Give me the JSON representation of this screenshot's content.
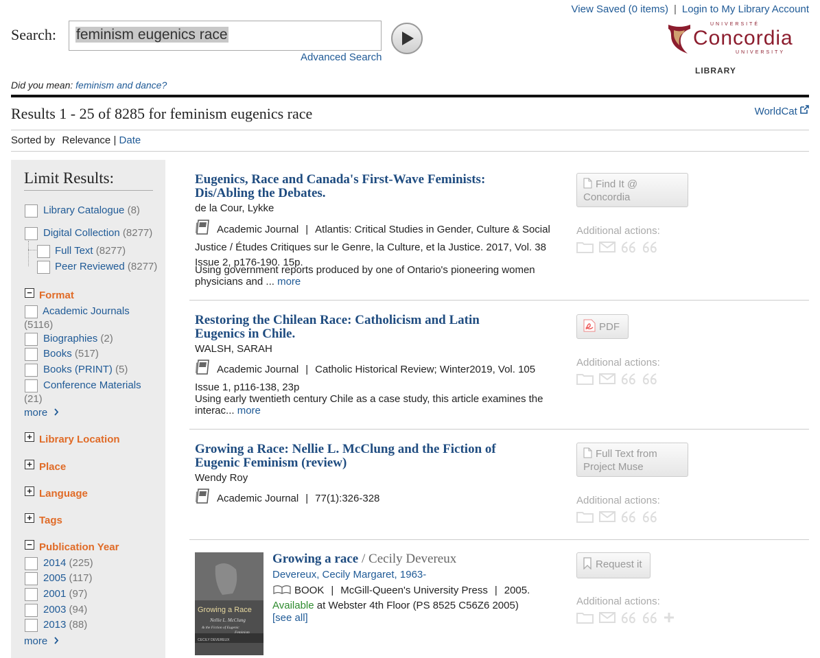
{
  "header": {
    "view_saved": "View Saved (0 items)",
    "separator": "|",
    "login": "Login to My Library Account"
  },
  "search": {
    "label": "Search:",
    "query": "feminism eugenics race",
    "advanced": "Advanced Search"
  },
  "logo": {
    "top": "UNIVERSITÉ",
    "name": "Concordia",
    "bottom": "UNIVERSITY",
    "library": "LIBRARY",
    "brand_color": "#8c1d2e"
  },
  "did_you_mean": {
    "prefix": "Did you mean: ",
    "suggestion": "feminism and dance?"
  },
  "results_header": {
    "title": "Results 1 - 25 of 8285 for feminism eugenics race",
    "worldcat": "WorldCat"
  },
  "sort": {
    "label": "Sorted by",
    "current": "Relevance",
    "sep": "|",
    "other": "Date"
  },
  "sidebar": {
    "heading": "Limit Results:",
    "top_facets": [
      {
        "label": "Library Catalogue",
        "count": "(8)"
      },
      {
        "label": "Digital Collection",
        "count": "(8277)"
      },
      {
        "label": "Full Text",
        "count": "(8277)"
      },
      {
        "label": "Peer Reviewed",
        "count": "(8277)"
      }
    ],
    "format": {
      "heading": "Format",
      "items": [
        {
          "label": "Academic Journals",
          "count": "(5116)"
        },
        {
          "label": "Biographies",
          "count": "(2)"
        },
        {
          "label": "Books",
          "count": "(517)"
        },
        {
          "label": "Books (PRINT)",
          "count": "(5)"
        },
        {
          "label": "Conference Materials",
          "count": "(21)"
        }
      ],
      "more": "more"
    },
    "collapsed": [
      "Library Location",
      "Place",
      "Language",
      "Tags"
    ],
    "pubyear": {
      "heading": "Publication Year",
      "items": [
        {
          "label": "2014",
          "count": "(225)"
        },
        {
          "label": "2005",
          "count": "(117)"
        },
        {
          "label": "2001",
          "count": "(97)"
        },
        {
          "label": "2003",
          "count": "(94)"
        },
        {
          "label": "2013",
          "count": "(88)"
        }
      ],
      "more": "more"
    },
    "accent_color": "#e06b27"
  },
  "results": [
    {
      "title_line1": "Eugenics, Race and Canada's First-Wave Feminists:",
      "title_line2": "Dis/Abling the Debates.",
      "author": "de la Cour, Lykke",
      "type": "Academic Journal",
      "source_line1": "Atlantis: Critical Studies in Gender, Culture & Social",
      "source_line2": "Justice / Études Critiques sur le Genre, la Culture, et la Justice. 2017, Vol. 38",
      "source_line3": "Issue 2, p176-190. 15p.",
      "desc_line1": "Using government reports produced by one of Ontario's pioneering women",
      "desc_line2": "physicians and ...",
      "more": "more",
      "button": "Find It @ Concordia",
      "button_line1": "Find It @",
      "button_line2": "Concordia",
      "additional": "Additional actions:"
    },
    {
      "title_line1": "Restoring the Chilean Race: Catholicism and Latin",
      "title_line2": "Eugenics in Chile.",
      "author": "WALSH, SARAH",
      "type": "Academic Journal",
      "source_line1": "Catholic Historical Review; Winter2019, Vol. 105",
      "source_line2": "Issue 1, p116-138, 23p",
      "desc_line1": "Using early twentieth century Chile as a case study, this article examines the",
      "desc_line2": "interac...",
      "more": "more",
      "button": "PDF",
      "additional": "Additional actions:"
    },
    {
      "title_line1": "Growing a Race: Nellie L. McClung and the Fiction of",
      "title_line2": "Eugenic Feminism (review)",
      "author": "Wendy Roy",
      "type": "Academic Journal",
      "source_line1": "77(1):326-328",
      "button_line1": "Full Text from",
      "button_line2": "Project Muse",
      "additional": "Additional actions:"
    },
    {
      "title": "Growing a race",
      "by": "/ Cecily Devereux",
      "author": "Devereux, Cecily Margaret, 1963-",
      "type": "BOOK",
      "publisher": "McGill-Queen's University Press",
      "year": "2005.",
      "available": "Available",
      "location": "at Webster 4th Floor (PS 8525 C56Z6 2005)",
      "see_all": "[see all]",
      "button": "Request it",
      "additional": "Additional actions:",
      "cover_title": "Growing a Race",
      "cover_sub1": "Nellie L. McClung",
      "cover_sub2": "& the Fiction of Eugenic",
      "cover_sub3": "Feminism",
      "cover_author": "CECILY DEVEREUX"
    }
  ]
}
